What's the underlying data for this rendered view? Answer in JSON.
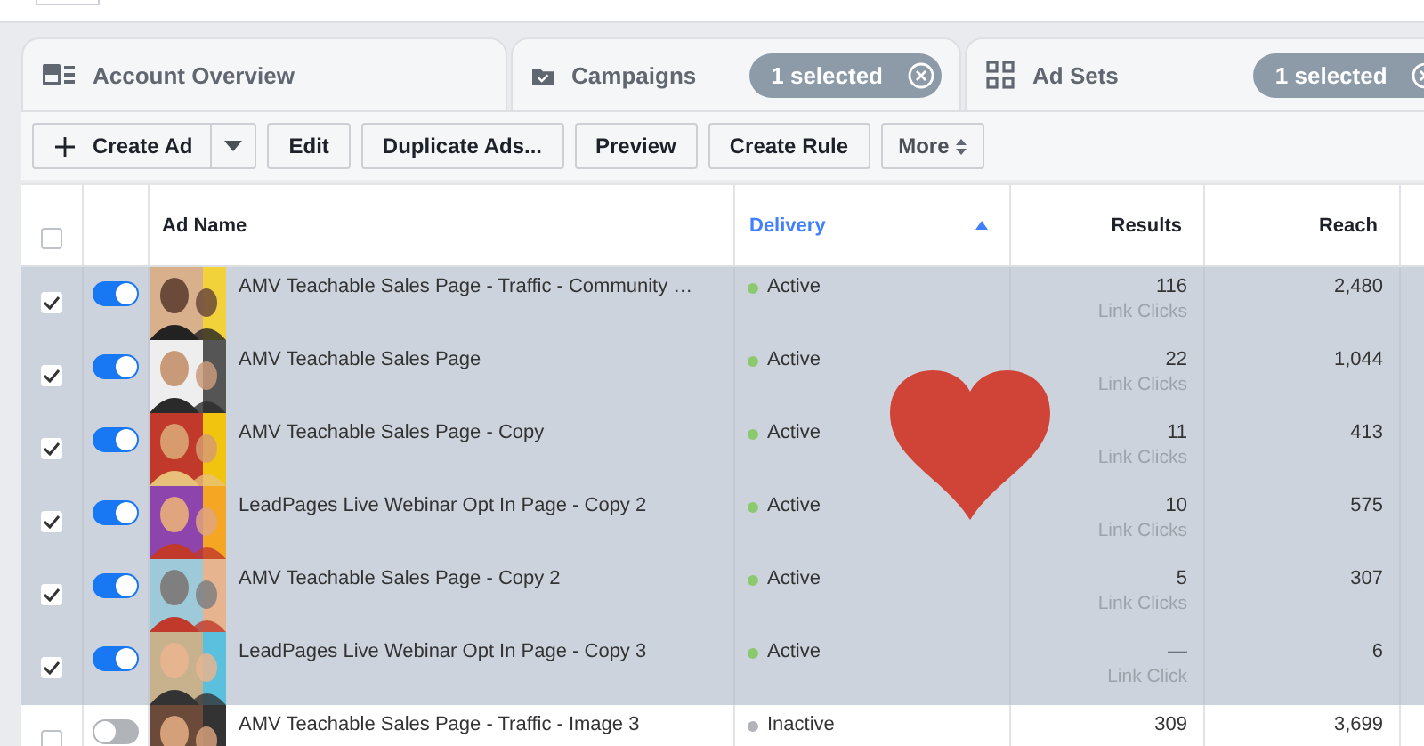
{
  "tabs": [
    {
      "label": "Account Overview",
      "kind": "overview"
    },
    {
      "label": "Campaigns",
      "kind": "folder",
      "badge": "1 selected"
    },
    {
      "label": "Ad Sets",
      "kind": "grid",
      "badge": "1 selected"
    }
  ],
  "toolbar": [
    {
      "label": "Create Ad",
      "kind": "create"
    },
    {
      "label": "Edit",
      "kind": "plain"
    },
    {
      "label": "Duplicate Ads...",
      "kind": "plain"
    },
    {
      "label": "Preview",
      "kind": "plain"
    },
    {
      "label": "Create Rule",
      "kind": "plain"
    },
    {
      "label": "More",
      "kind": "more"
    }
  ],
  "table": {
    "header_checkbox": {
      "checked": false
    },
    "columns": [
      {
        "label": "Ad Name",
        "sorted": false
      },
      {
        "label": "Delivery",
        "sorted": true
      },
      {
        "label": "Results",
        "sorted": false
      },
      {
        "label": "Reach",
        "sorted": false
      }
    ],
    "rows": [
      {
        "checked": true,
        "on": true,
        "name": "AMV Teachable Sales Page - Traffic - Community …",
        "delivery": "Active",
        "color": "#8bc96f",
        "results": "116",
        "result_type": "Link Clicks",
        "reach": "2,480"
      },
      {
        "checked": true,
        "on": true,
        "name": "AMV Teachable Sales Page",
        "delivery": "Active",
        "color": "#8bc96f",
        "results": "22",
        "result_type": "Link Clicks",
        "reach": "1,044"
      },
      {
        "checked": true,
        "on": true,
        "name": "AMV Teachable Sales Page - Copy",
        "delivery": "Active",
        "color": "#8bc96f",
        "results": "11",
        "result_type": "Link Clicks",
        "reach": "413"
      },
      {
        "checked": true,
        "on": true,
        "name": "LeadPages Live Webinar Opt In Page - Copy 2",
        "delivery": "Active",
        "color": "#8bc96f",
        "results": "10",
        "result_type": "Link Clicks",
        "reach": "575"
      },
      {
        "checked": true,
        "on": true,
        "name": "AMV Teachable Sales Page - Copy 2",
        "delivery": "Active",
        "color": "#8bc96f",
        "results": "5",
        "result_type": "Link Clicks",
        "reach": "307"
      },
      {
        "checked": true,
        "on": true,
        "name": "LeadPages Live Webinar Opt In Page - Copy 3",
        "delivery": "Active",
        "color": "#8bc96f",
        "results": "—",
        "result_type": "Link Click",
        "reach": "6"
      },
      {
        "checked": false,
        "on": false,
        "name": "AMV Teachable Sales Page - Traffic - Image 3",
        "delivery": "Inactive",
        "color": "#b0b3b8",
        "results": "309",
        "reach": "3,699"
      }
    ]
  }
}
